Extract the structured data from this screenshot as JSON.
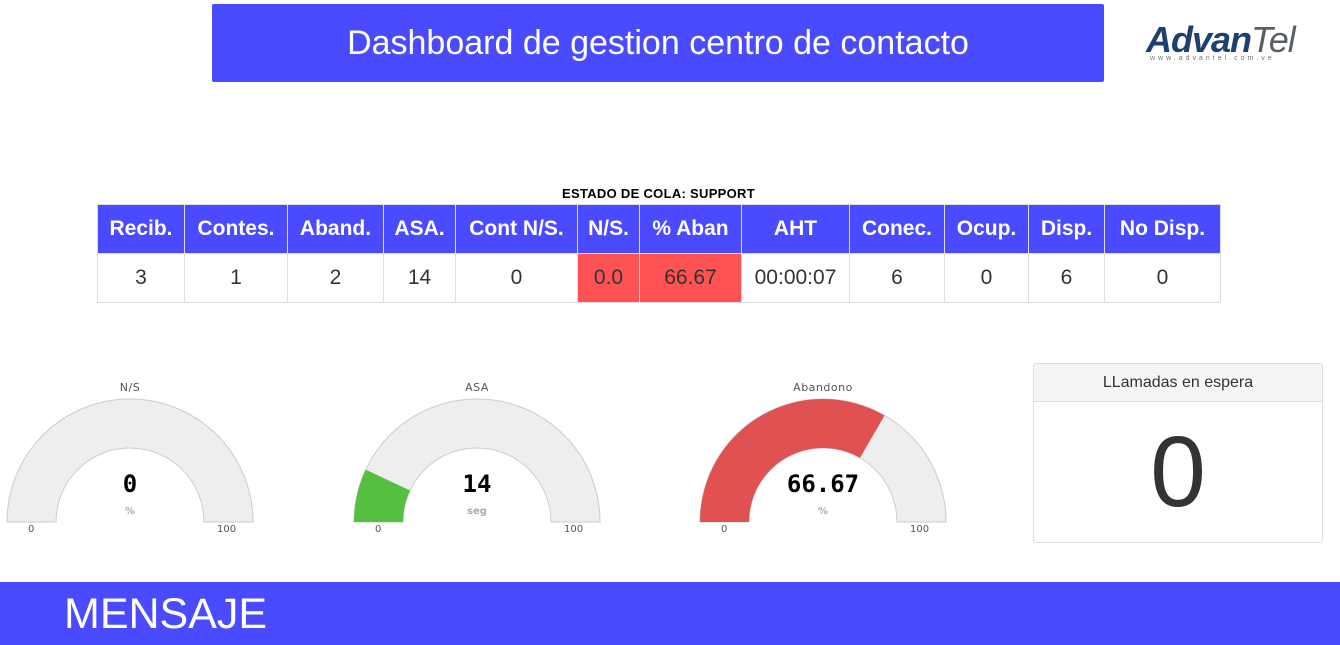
{
  "header": {
    "title": "Dashboard de gestion centro de contacto",
    "brand_color": "#4a4aff"
  },
  "logo": {
    "part1": "Advan",
    "part2": "Tel",
    "url": "www.advantel.com.ve"
  },
  "queue": {
    "caption": "ESTADO DE COLA: SUPPORT",
    "columns": [
      "Recib.",
      "Contes.",
      "Aband.",
      "ASA.",
      "Cont N/S.",
      "N/S.",
      "% Aban",
      "AHT",
      "Conec.",
      "Ocup.",
      "Disp.",
      "No Disp."
    ],
    "values": [
      "3",
      "1",
      "2",
      "14",
      "0",
      "0.0",
      "66.67",
      "00:00:07",
      "6",
      "0",
      "6",
      "0"
    ],
    "alert_color": "#ff5252"
  },
  "gauges": [
    {
      "title": "N/S",
      "value": 0,
      "value_text": "0",
      "unit": "%",
      "min": 0,
      "max": 100,
      "min_text": "0",
      "max_text": "100",
      "color": "#5ac243"
    },
    {
      "title": "ASA",
      "value": 14,
      "value_text": "14",
      "unit": "seg",
      "min": 0,
      "max": 100,
      "min_text": "0",
      "max_text": "100",
      "color": "#54bf40"
    },
    {
      "title": "Abandono",
      "value": 66.67,
      "value_text": "66.67",
      "unit": "%",
      "min": 0,
      "max": 100,
      "min_text": "0",
      "max_text": "100",
      "color": "#e05252"
    }
  ],
  "waiting": {
    "title": "LLamadas en espera",
    "value": "0"
  },
  "message": {
    "label": "MENSAJE"
  }
}
